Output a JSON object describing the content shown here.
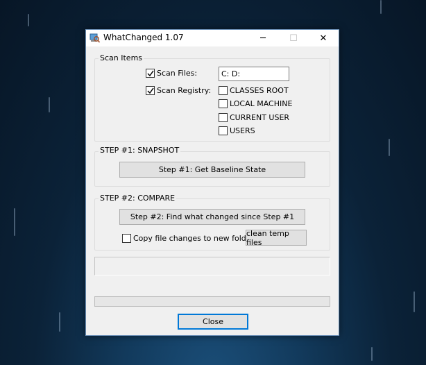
{
  "window": {
    "title": "WhatChanged 1.07",
    "controls": {
      "minimize": "─",
      "maximize": "☐",
      "close": "✕"
    }
  },
  "scan_items": {
    "label": "Scan Items",
    "scan_files": {
      "label": "Scan Files:",
      "checked": true,
      "value": "C: D:"
    },
    "scan_registry": {
      "label": "Scan Registry:",
      "checked": true
    },
    "hives": [
      {
        "label": "CLASSES ROOT",
        "checked": false
      },
      {
        "label": "LOCAL MACHINE",
        "checked": false
      },
      {
        "label": "CURRENT USER",
        "checked": false
      },
      {
        "label": "USERS",
        "checked": false
      }
    ]
  },
  "step1": {
    "label": "STEP #1:  SNAPSHOT",
    "button": "Step #1:  Get Baseline State"
  },
  "step2": {
    "label": "STEP #2:  COMPARE",
    "button": "Step #2:  Find what changed since Step #1",
    "copy_changes": {
      "label": "Copy file changes to new folder",
      "checked": false
    },
    "clean_button": "clean temp files"
  },
  "status_text": "",
  "progress": 0,
  "close_button": "Close",
  "colors": {
    "accent": "#0078d7",
    "window_bg": "#f0f0f0",
    "button_bg": "#e1e1e1"
  }
}
